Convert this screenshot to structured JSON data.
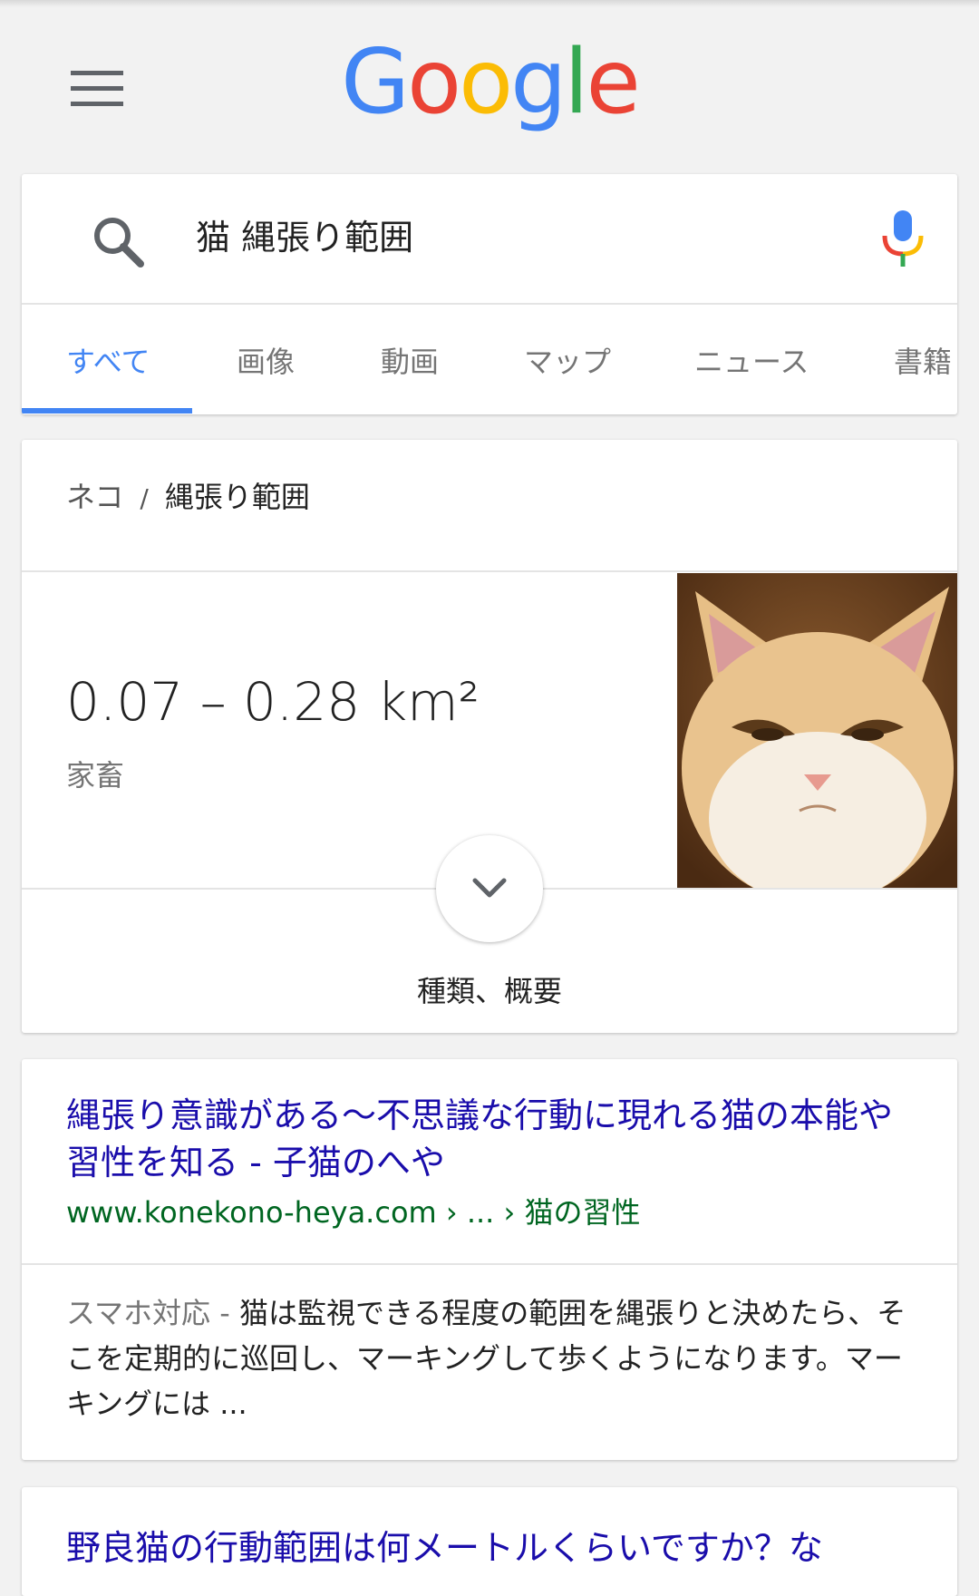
{
  "header": {
    "logo_text": "Google"
  },
  "search": {
    "query": "猫 縄張り範囲"
  },
  "tabs": [
    {
      "label": "すべて"
    },
    {
      "label": "画像"
    },
    {
      "label": "動画"
    },
    {
      "label": "マップ"
    },
    {
      "label": "ニュース"
    },
    {
      "label": "書籍"
    }
  ],
  "knowledge_panel": {
    "breadcrumb": [
      "ネコ",
      "縄張り範囲"
    ],
    "breadcrumb_separator": "/",
    "value": "0.07 – 0.28 km²",
    "sublabel": "家畜",
    "image_icon": "cat-photo",
    "expand_label": "種類、概要"
  },
  "results": [
    {
      "title": "縄張り意識がある～不思議な行動に現れる猫の本能や習性を知る - 子猫のへや",
      "url": "www.konekono-heya.com › ... › 猫の習性",
      "snippet_tag": "スマホ対応 - ",
      "snippet": "猫は監視できる程度の範囲を縄張りと決めたら、そこを定期的に巡回し、マーキングして歩くようになります。マーキングには ..."
    },
    {
      "title": "野良猫の行動範囲は何メートルくらいですか？な"
    }
  ],
  "colors": {
    "accent": "#4285F4",
    "link": "#1a0dab",
    "url": "#006621"
  }
}
